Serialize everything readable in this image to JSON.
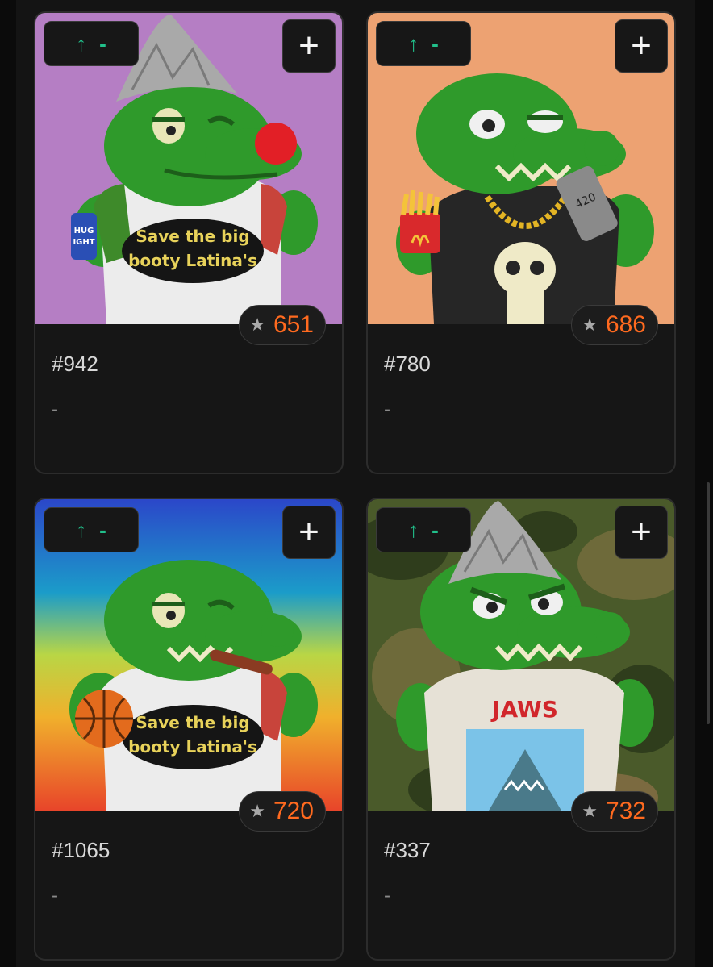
{
  "cards": [
    {
      "name": "#942",
      "subtitle": "-",
      "rank": "651",
      "upvote_arrow": "↑",
      "upvote_count": "-",
      "add_label": "+",
      "background": "#b57ec4",
      "shirt_text_1": "Save the big",
      "shirt_text_2": "booty Latina's",
      "can_text_1": "HUG",
      "can_text_2": "IGHT"
    },
    {
      "name": "#780",
      "subtitle": "-",
      "rank": "686",
      "upvote_arrow": "↑",
      "upvote_count": "-",
      "add_label": "+",
      "background": "#eda272",
      "phone_text": "420"
    },
    {
      "name": "#1065",
      "subtitle": "-",
      "rank": "720",
      "upvote_arrow": "↑",
      "upvote_count": "-",
      "add_label": "+",
      "background": "rainbow",
      "shirt_text_1": "Save the big",
      "shirt_text_2": "booty Latina's"
    },
    {
      "name": "#337",
      "subtitle": "-",
      "rank": "732",
      "upvote_arrow": "↑",
      "upvote_count": "-",
      "add_label": "+",
      "background": "camo",
      "shirt_text_1": "JAWS"
    }
  ],
  "colors": {
    "accent_green": "#21c08b",
    "rank_orange": "#ff6a1f",
    "croc_green": "#2f9a2b"
  },
  "icons": {
    "upvote": "arrow-up-icon",
    "add": "plus-icon",
    "rank": "star-icon"
  }
}
